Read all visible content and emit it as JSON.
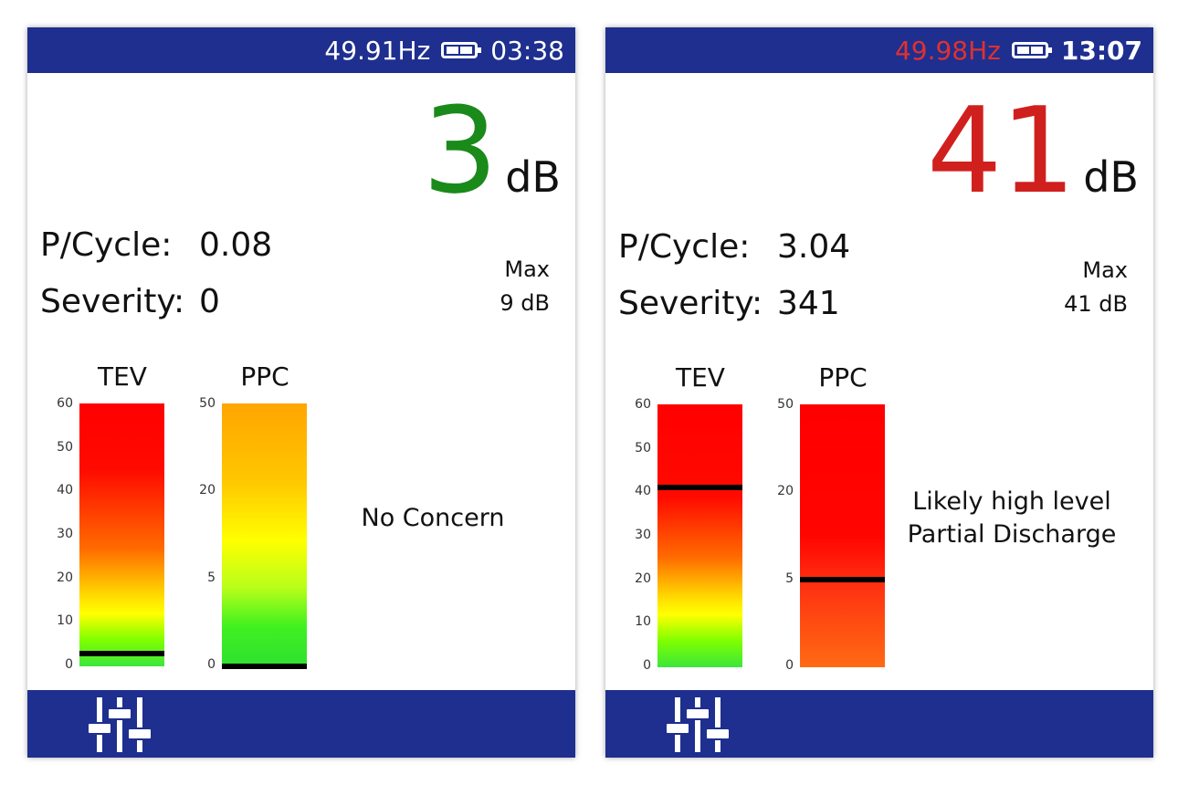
{
  "screens": [
    {
      "status": {
        "frequency": "49.91Hz",
        "time": "03:38",
        "frequency_color": "#ffffff"
      },
      "reading": {
        "value": "3",
        "unit": "dB",
        "value_color": "#1a8a1a"
      },
      "stats": {
        "pcycle_label": "P/Cycle:",
        "pcycle_value": "0.08",
        "severity_label": "Severity:",
        "severity_value": "0"
      },
      "max": {
        "label": "Max",
        "value": "9 dB"
      },
      "tev": {
        "title": "TEV",
        "ticks": [
          "60",
          "50",
          "40",
          "30",
          "20",
          "10",
          "0"
        ],
        "level_db": 3
      },
      "ppc": {
        "title": "PPC",
        "ticks": [
          "50",
          "20",
          "5",
          "0"
        ],
        "level": 0
      },
      "verdict": "No Concern",
      "icon": "settings-sliders-icon"
    },
    {
      "status": {
        "frequency": "49.98Hz",
        "time": "13:07",
        "frequency_color": "#e0312f"
      },
      "reading": {
        "value": "41",
        "unit": "dB",
        "value_color": "#d0201e"
      },
      "stats": {
        "pcycle_label": "P/Cycle:",
        "pcycle_value": "3.04",
        "severity_label": "Severity:",
        "severity_value": "341"
      },
      "max": {
        "label": "Max",
        "value": "41 dB"
      },
      "tev": {
        "title": "TEV",
        "ticks": [
          "60",
          "50",
          "40",
          "30",
          "20",
          "10",
          "0"
        ],
        "level_db": 41
      },
      "ppc": {
        "title": "PPC",
        "ticks": [
          "50",
          "20",
          "5",
          "0"
        ],
        "level": 5
      },
      "verdict_lines": [
        "Likely high level",
        "Partial Discharge"
      ],
      "icon": "settings-sliders-icon"
    }
  ]
}
